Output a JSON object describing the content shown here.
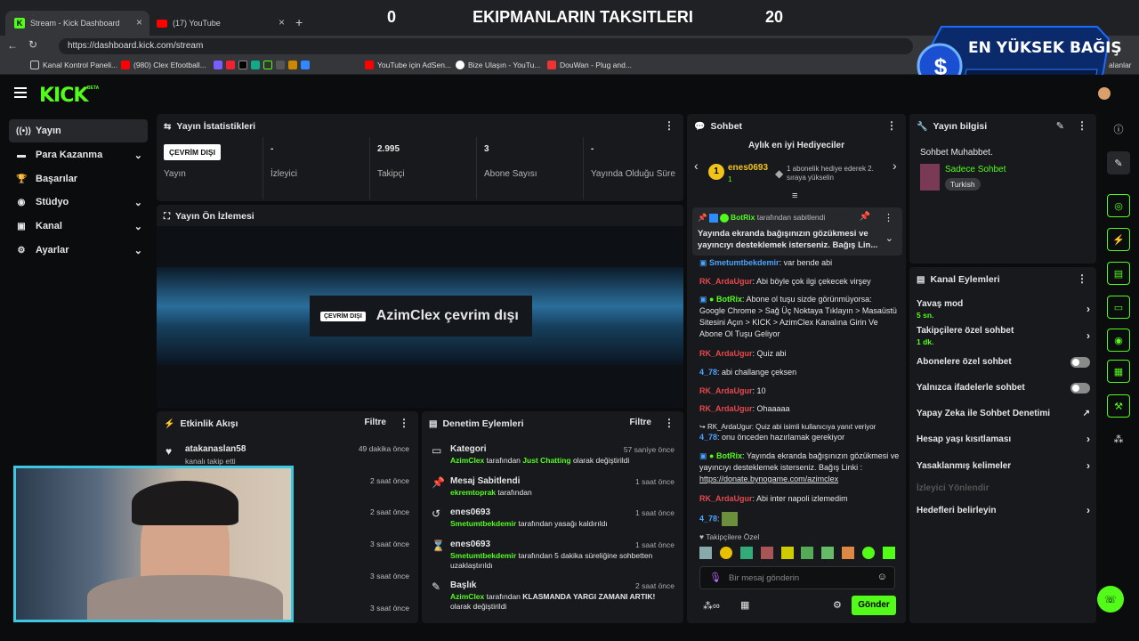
{
  "browser": {
    "tabs": [
      {
        "label": "Stream - Kick Dashboard"
      },
      {
        "label": "(17) YouTube"
      }
    ],
    "url": "https://dashboard.kick.com/stream",
    "bookmarks": [
      "Kanal Kontrol Paneli...",
      "(980) Clex Efootball...",
      "YouTube için AdSen...",
      "Bize Ulaşın - YouTu...",
      "DouWan - Plug and..."
    ],
    "bookmark_right": "alanlar"
  },
  "overlay": {
    "left_score": "0",
    "title": "EKIPMANLARIN TAKSITLERI",
    "right_score": "20"
  },
  "badge": {
    "title": "EN YÜKSEK BAĞIŞ",
    "currency_symbol": "$",
    "lira": "₺"
  },
  "logo": "KICK",
  "logo_sup": "BETA",
  "sidebar": {
    "items": [
      {
        "label": "Yayın",
        "icon": "broadcast-icon",
        "glyph": "((•))"
      },
      {
        "label": "Para Kazanma",
        "icon": "money-icon",
        "glyph": "▬"
      },
      {
        "label": "Başarılar",
        "icon": "trophy-icon",
        "glyph": "🏆"
      },
      {
        "label": "Stüdyo",
        "icon": "studio-icon",
        "glyph": "◉"
      },
      {
        "label": "Kanal",
        "icon": "channel-icon",
        "glyph": "▣"
      },
      {
        "label": "Ayarlar",
        "icon": "settings-icon",
        "glyph": "⚙"
      }
    ]
  },
  "stats": {
    "title": "Yayın İstatistikleri",
    "cells": [
      {
        "value": "ÇEVRİM DIŞI",
        "label": "Yayın"
      },
      {
        "value": "-",
        "label": "İzleyici"
      },
      {
        "value": "2.995",
        "label": "Takipçi"
      },
      {
        "value": "3",
        "label": "Abone Sayısı"
      },
      {
        "value": "-",
        "label": "Yayında Olduğu Süre"
      }
    ]
  },
  "preview": {
    "title": "Yayın Ön İzlemesi",
    "offline_badge": "ÇEVRİM DIŞI",
    "offline_text": "AzimClex çevrim dışı"
  },
  "activity": {
    "title": "Etkinlik Akışı",
    "filter": "Filtre",
    "items": [
      {
        "name": "atakanaslan58",
        "sub": "kanalı takip etti",
        "time": "49 dakika önce"
      },
      {
        "time": "2 saat önce"
      },
      {
        "time": "2 saat önce"
      },
      {
        "time": "3 saat önce"
      },
      {
        "time": "3 saat önce"
      },
      {
        "time": "3 saat önce"
      }
    ]
  },
  "moderation": {
    "title": "Denetim Eylemleri",
    "filter": "Filtre",
    "items": [
      {
        "title": "Kategori",
        "time": "57 saniye önce",
        "actor": "AzimClex",
        "mid": " tarafından ",
        "highlight": "Just Chatting",
        "rest": " olarak değiştirildi"
      },
      {
        "title": "Mesaj Sabitlendi",
        "time": "1 saat önce",
        "actor": "ekremtoprak",
        "mid": " tarafından",
        "highlight": "",
        "rest": ""
      },
      {
        "title": "enes0693",
        "time": "1 saat önce",
        "actor": "Smetumtbekdemir",
        "mid": " tarafından yasağı kaldırıldı",
        "highlight": "",
        "rest": ""
      },
      {
        "title": "enes0693",
        "time": "1 saat önce",
        "actor": "Smetumtbekdemir",
        "mid": " tarafından 5 dakika süreliğine sohbetten uzaklaştırıldı",
        "highlight": "",
        "rest": ""
      },
      {
        "title": "Başlık",
        "time": "2 saat önce",
        "actor": "AzimClex",
        "mid": " tarafından ",
        "highlight": "KLASMANDA YARGI ZAMANI ARTIK!",
        "rest": " olarak değiştirildi"
      }
    ]
  },
  "chat": {
    "title": "Sohbet",
    "gifters_title": "Aylık en iyi Hediyeciler",
    "top_gifter": "enes0693",
    "top_gifter_rank": "1",
    "top_gifter_count": "1",
    "gifter_hint": "1 abonelik hediye ederek 2. sıraya yükselin",
    "pinned_by": "BotRix",
    "pinned_suffix": " tarafından sabitlendi",
    "pinned_text": "Yayında ekranda bağışınızın gözükmesi ve yayıncıyı desteklemek isterseniz. Bağış Lin...",
    "messages": [
      {
        "user": "Smetumtbekdemir",
        "text": ": var bende abi"
      },
      {
        "user": "RK_ArdaUgur",
        "text": ": Abi böyle çok ilgi çekecek virşey"
      },
      {
        "user": "BotRix",
        "text": ": Abone ol tuşu sizde görünmüyorsa: Google Chrome > Sağ Üç Noktaya Tıklayın > Masaüstü Sitesini Açın > KICK > AzimClex Kanalına Girin Ve Abone Ol Tuşu Geliyor"
      },
      {
        "user": "RK_ArdaUgur",
        "text": ": Quiz abi"
      },
      {
        "user": "4_78",
        "text": ": abi challange çeksen"
      },
      {
        "user": "RK_ArdaUgur",
        "text": ": 10"
      },
      {
        "user": "RK_ArdaUgur",
        "text": ": Ohaaaaa"
      },
      {
        "user": "4_78",
        "text": ": onu önceden hazırlamak gerekiyor"
      },
      {
        "user": "BotRix",
        "text": ": Yayında ekranda bağışınızın gözükmesi ve yayıncıyı desteklemek isterseniz. Bağış Linki : "
      },
      {
        "user": "RK_ArdaUgur",
        "text": ": Abi inter napoli izlemedim"
      },
      {
        "user": "4_78",
        "text": ":"
      }
    ],
    "reply_hint": "RK_ArdaUgur: Quiz abi isimli kullanıcıya yanıt veriyor",
    "donate_link": "https://donate.bynogame.com/azimclex",
    "followers_only": "Takipçilere Özel",
    "placeholder": "Bir mesaj gönderin",
    "send": "Gönder"
  },
  "stream_info": {
    "title": "Yayın bilgisi",
    "stream_title": "Sohbet Muhabbet.",
    "category": "Sadece Sohbet",
    "tag": "Turkish"
  },
  "channel_actions": {
    "title": "Kanal Eylemleri",
    "items": [
      {
        "label": "Yavaş mod",
        "sub": "5 sn."
      },
      {
        "label": "Takipçilere özel sohbet",
        "sub": "1 dk."
      },
      {
        "label": "Abonelere özel sohbet",
        "sub": ""
      },
      {
        "label": "Yalnızca ifadelerle sohbet",
        "sub": ""
      },
      {
        "label": "Yapay Zeka ile Sohbet Denetimi",
        "sub": ""
      },
      {
        "label": "Hesap yaşı kısıtlaması",
        "sub": ""
      },
      {
        "label": "Yasaklanmış kelimeler",
        "sub": ""
      },
      {
        "label": "İzleyici Yönlendir",
        "sub": ""
      },
      {
        "label": "Hedefleri belirleyin",
        "sub": ""
      }
    ]
  },
  "colors": {
    "accent": "#53fc18",
    "panel": "#18191c",
    "bg": "#0b0c0e",
    "red_user": "#e5484d",
    "blue_user": "#4aa3ff"
  }
}
